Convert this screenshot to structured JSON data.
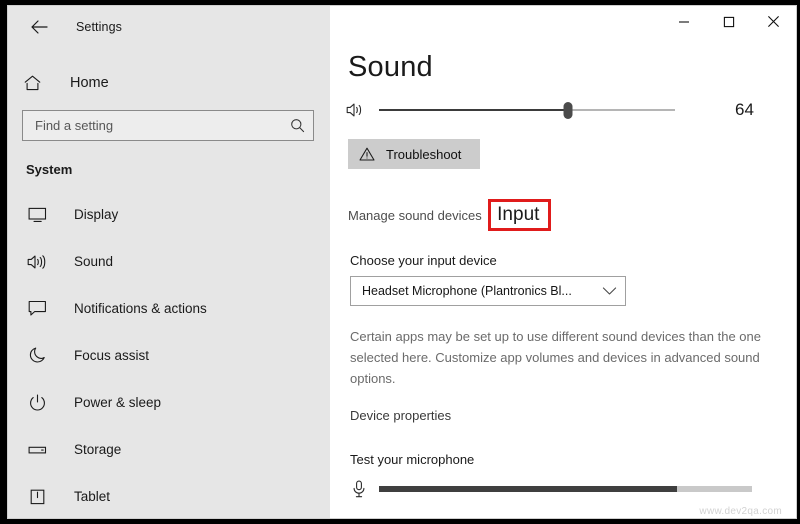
{
  "window": {
    "app_title": "Settings",
    "back_icon": "back-arrow-icon",
    "controls": {
      "minimize": "–",
      "maximize": "□",
      "close": "✕"
    }
  },
  "sidebar": {
    "home_label": "Home",
    "home_icon": "home-icon",
    "search": {
      "placeholder": "Find a setting",
      "value": "",
      "icon": "search-icon"
    },
    "group_title": "System",
    "items": [
      {
        "label": "Display",
        "icon": "monitor-icon"
      },
      {
        "label": "Sound",
        "icon": "speaker-icon"
      },
      {
        "label": "Notifications & actions",
        "icon": "speech-bubble-icon"
      },
      {
        "label": "Focus assist",
        "icon": "moon-icon"
      },
      {
        "label": "Power & sleep",
        "icon": "power-icon"
      },
      {
        "label": "Storage",
        "icon": "drive-icon"
      },
      {
        "label": "Tablet",
        "icon": "tablet-icon"
      }
    ]
  },
  "main": {
    "page_title": "Sound",
    "volume": {
      "icon": "speaker-icon",
      "value": "64",
      "percent": 64
    },
    "troubleshoot": {
      "label": "Troubleshoot",
      "icon": "warning-triangle-icon"
    },
    "manage_sound_devices_link": "Manage sound devices",
    "input_section": {
      "heading": "Input",
      "highlight_color": "#e01b1b",
      "choose_device_label": "Choose your input device",
      "device_value": "Headset Microphone (Plantronics Bl...",
      "device_caret": "chevron-down-icon",
      "description": "Certain apps may be set up to use different sound devices than the one selected here. Customize app volumes and devices in advanced sound options.",
      "device_properties_link": "Device properties",
      "test_label": "Test your microphone",
      "mic_icon": "microphone-icon",
      "mic_level_percent": 80
    }
  },
  "watermark": "www.dev2qa.com"
}
